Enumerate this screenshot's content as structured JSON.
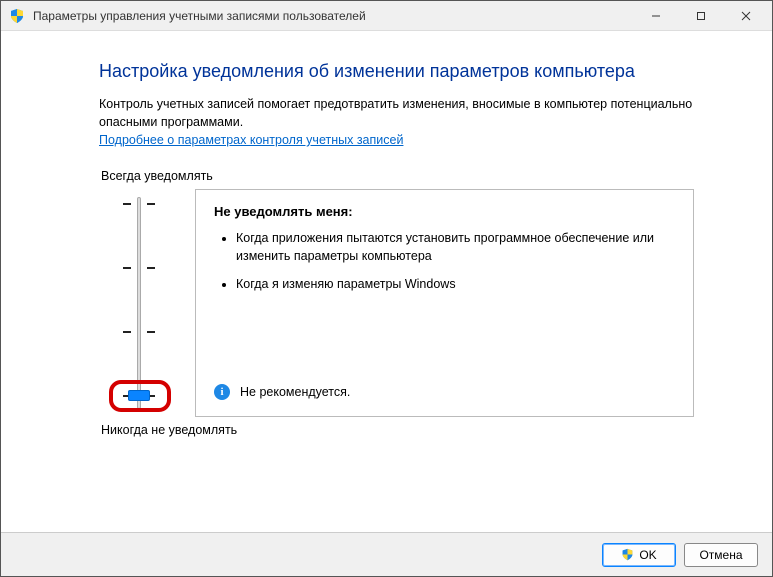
{
  "window": {
    "title": "Параметры управления учетными записями пользователей"
  },
  "main": {
    "heading": "Настройка уведомления об изменении параметров компьютера",
    "intro": "Контроль учетных записей помогает предотвратить изменения, вносимые в компьютер потенциально опасными программами.",
    "link": "Подробнее о параметрах контроля учетных записей"
  },
  "slider": {
    "top_label": "Всегда уведомлять",
    "bottom_label": "Никогда не уведомлять",
    "level_count": 4,
    "current_level": 0
  },
  "panel": {
    "title": "Не уведомлять меня:",
    "bullets": [
      "Когда приложения пытаются установить программное обеспечение или изменить параметры компьютера",
      "Когда я изменяю параметры Windows"
    ],
    "note": "Не рекомендуется."
  },
  "buttons": {
    "ok": "OK",
    "cancel": "Отмена"
  }
}
